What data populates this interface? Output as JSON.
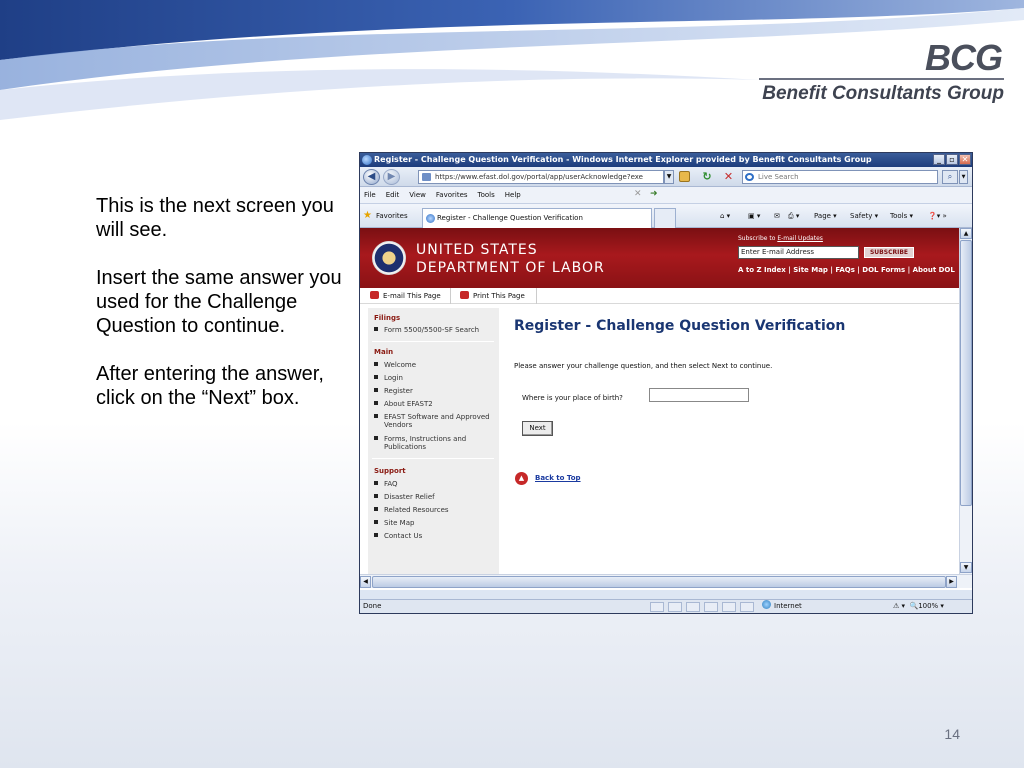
{
  "slide": {
    "logo_mark": "BCG",
    "logo_text": "Benefit Consultants Group",
    "instructions": [
      "This is the next screen you will see.",
      "Insert the same answer you used for the Challenge Question to continue.",
      "After entering the answer, click on the “Next” box."
    ],
    "page_number": "14"
  },
  "browser": {
    "title": "Register - Challenge Question Verification - Windows Internet Explorer provided by Benefit Consultants Group",
    "window_buttons": [
      "_",
      "▫",
      "✕"
    ],
    "url": "https://www.efast.dol.gov/portal/app/userAcknowledge?exe",
    "search_placeholder": "Live Search",
    "menu": [
      "File",
      "Edit",
      "View",
      "Favorites",
      "Tools",
      "Help"
    ],
    "favorites_label": "Favorites",
    "tab_label": "Register - Challenge Question Verification",
    "commands": [
      "Page ▾",
      "Safety ▾",
      "Tools ▾"
    ],
    "status": {
      "done": "Done",
      "zone": "Internet",
      "zoom": "100%"
    }
  },
  "site": {
    "agency_line1": "UNITED STATES",
    "agency_line2": "DEPARTMENT OF LABOR",
    "subscribe_prefix": "Subscribe to ",
    "subscribe_link": "E-mail Updates",
    "email_placeholder": "Enter E-mail Address",
    "subscribe_button": "SUBSCRIBE",
    "top_links": "A to Z Index | Site Map | FAQs | DOL Forms | About DOL",
    "page_tools": [
      "E-mail This Page",
      "Print This Page"
    ],
    "nav": {
      "filings_heading": "Filings",
      "filings_items": [
        "Form 5500/5500-SF Search"
      ],
      "main_heading": "Main",
      "main_items": [
        "Welcome",
        "Login",
        "Register",
        "About EFAST2",
        "EFAST Software and Approved Vendors",
        "Forms, Instructions and Publications"
      ],
      "support_heading": "Support",
      "support_items": [
        "FAQ",
        "Disaster Relief",
        "Related Resources",
        "Site Map",
        "Contact Us"
      ]
    },
    "heading": "Register - Challenge Question Verification",
    "instruction": "Please answer your challenge question, and then select Next to continue.",
    "question": "Where is your place of birth?",
    "answer_value": "",
    "next_button": "Next",
    "back_to_top": "Back to Top"
  }
}
